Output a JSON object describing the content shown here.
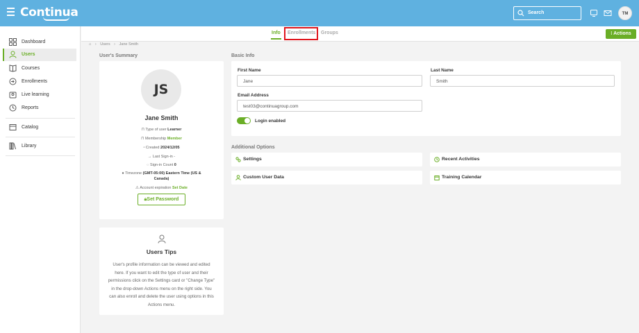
{
  "app": {
    "logo": "Continua"
  },
  "header": {
    "search_label": "Search",
    "user_initials": "TM"
  },
  "sidebar": {
    "items": [
      {
        "label": "Dashboard",
        "icon": "dashboard-icon"
      },
      {
        "label": "Users",
        "icon": "user-icon",
        "active": true
      },
      {
        "label": "Courses",
        "icon": "book-icon"
      },
      {
        "label": "Enrollments",
        "icon": "enroll-icon"
      },
      {
        "label": "Live learning",
        "icon": "live-learning-icon"
      },
      {
        "label": "Reports",
        "icon": "clock-icon"
      },
      {
        "label": "Catalog",
        "icon": "catalog-icon"
      },
      {
        "label": "Library",
        "icon": "library-icon"
      }
    ]
  },
  "tabs": [
    {
      "label": "Info",
      "active": true
    },
    {
      "label": "Enrollments"
    },
    {
      "label": "Groups"
    }
  ],
  "actions_label": "⁝ Actions",
  "breadcrumb": [
    "Users",
    "Jane Smith"
  ],
  "summary": {
    "section_title": "User's Summary",
    "initials": "JS",
    "name": "Jane Smith",
    "type_label": "Type of user",
    "type_value": "Learner",
    "membership_label": "Membership",
    "membership_value": "Member",
    "created_label": "Created",
    "created_value": "2024/12/05",
    "last_signin": "Last Sign-in -",
    "signin_count_label": "Sign-in Count",
    "signin_count_value": "0",
    "timezone_label": "Timezone",
    "timezone_value_1": "(GMT-05:00) Eastern Time (US &",
    "timezone_value_2": "Canada)",
    "expiration_label": "Account expiration",
    "expiration_value": "Set Date",
    "set_password": "Set Password"
  },
  "tips": {
    "title": "Users Tips",
    "body": "User's profile information can be viewed and edited here. If you want to edit the type of user and their permissions click on the Settings card or \"Change Type\" in the drop-down Actions menu on the right side. You can also enroll and delete the user using options in this Actions menu."
  },
  "basic_info": {
    "section_title": "Basic Info",
    "first_name_label": "First Name",
    "first_name_value": "Jane",
    "last_name_label": "Last Name",
    "last_name_value": "Smith",
    "email_label": "Email Address",
    "email_value": "test03@continuagroup.com",
    "login_label": "Login enabled",
    "login_enabled": true
  },
  "additional": {
    "section_title": "Additional Options",
    "options": [
      "Settings",
      "Recent Activities",
      "Custom User Data",
      "Training Calendar"
    ]
  },
  "colors": {
    "brand_blue": "#5fb1e0",
    "accent_green": "#6aae26",
    "highlight_red": "#e0141b"
  }
}
